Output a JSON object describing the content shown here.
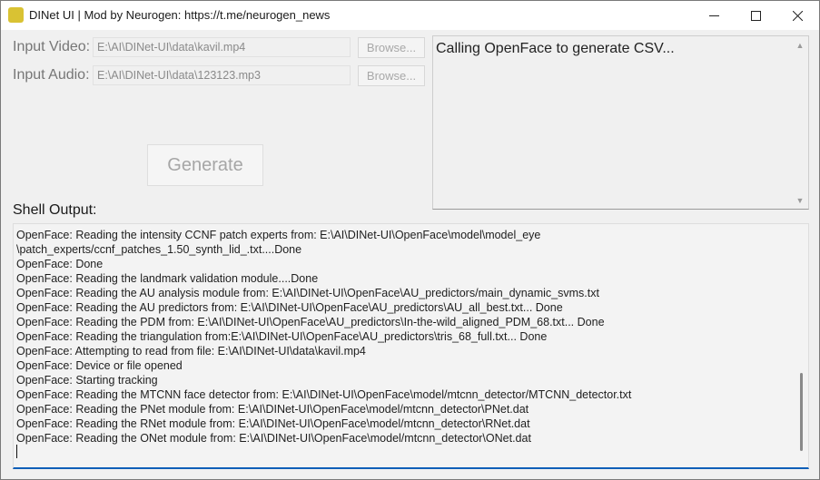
{
  "window": {
    "title": "DINet UI | Mod by Neurogen: https://t.me/neurogen_news"
  },
  "inputs": {
    "video_label": "Input Video:",
    "video_path": "E:\\AI\\DINet-UI\\data\\kavil.mp4",
    "audio_label": "Input Audio:",
    "audio_path": "E:\\AI\\DINet-UI\\data\\123123.mp3",
    "browse_label": "Browse..."
  },
  "generate_label": "Generate",
  "status_text": "Calling OpenFace to generate CSV...",
  "shell": {
    "label": "Shell Output:",
    "lines": [
      "OpenFace: Reading the intensity CCNF patch experts from: E:\\AI\\DINet-UI\\OpenFace\\model\\model_eye",
      "\\patch_experts/ccnf_patches_1.50_synth_lid_.txt....Done",
      "OpenFace: Done",
      "OpenFace: Reading the landmark validation module....Done",
      "OpenFace: Reading the AU analysis module from: E:\\AI\\DINet-UI\\OpenFace\\AU_predictors/main_dynamic_svms.txt",
      "OpenFace: Reading the AU predictors from: E:\\AI\\DINet-UI\\OpenFace\\AU_predictors\\AU_all_best.txt... Done",
      "OpenFace: Reading the PDM from: E:\\AI\\DINet-UI\\OpenFace\\AU_predictors\\In-the-wild_aligned_PDM_68.txt... Done",
      "OpenFace: Reading the triangulation from:E:\\AI\\DINet-UI\\OpenFace\\AU_predictors\\tris_68_full.txt... Done",
      "OpenFace: Attempting to read from file: E:\\AI\\DINet-UI\\data\\kavil.mp4",
      "OpenFace: Device or file opened",
      "OpenFace: Starting tracking",
      "OpenFace: Reading the MTCNN face detector from: E:\\AI\\DINet-UI\\OpenFace\\model/mtcnn_detector/MTCNN_detector.txt",
      "OpenFace: Reading the PNet module from: E:\\AI\\DINet-UI\\OpenFace\\model/mtcnn_detector\\PNet.dat",
      "OpenFace: Reading the RNet module from: E:\\AI\\DINet-UI\\OpenFace\\model/mtcnn_detector\\RNet.dat",
      "OpenFace: Reading the ONet module from: E:\\AI\\DINet-UI\\OpenFace\\model/mtcnn_detector\\ONet.dat"
    ]
  },
  "icons": {
    "app": "app-logo-icon",
    "minimize": "minimize-icon",
    "maximize": "maximize-icon",
    "close": "close-icon",
    "scroll_up": "scroll-up-arrow-icon",
    "scroll_down": "scroll-down-arrow-icon"
  }
}
